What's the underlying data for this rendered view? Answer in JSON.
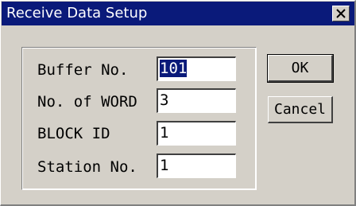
{
  "window": {
    "title": "Receive Data Setup"
  },
  "form": {
    "buffer_no_label": "Buffer No.",
    "buffer_no_value": "101",
    "no_of_word_label": "No. of WORD",
    "no_of_word_value": "3",
    "block_id_label": "BLOCK ID",
    "block_id_value": "1",
    "station_no_label": "Station No.",
    "station_no_value": "1"
  },
  "buttons": {
    "ok_label": "OK",
    "cancel_label": "Cancel"
  },
  "icons": {
    "close": "close-icon"
  },
  "colors": {
    "titlebar": "#0a1a7a",
    "selection": "#0a1a7a",
    "face": "#d4d0c8"
  }
}
